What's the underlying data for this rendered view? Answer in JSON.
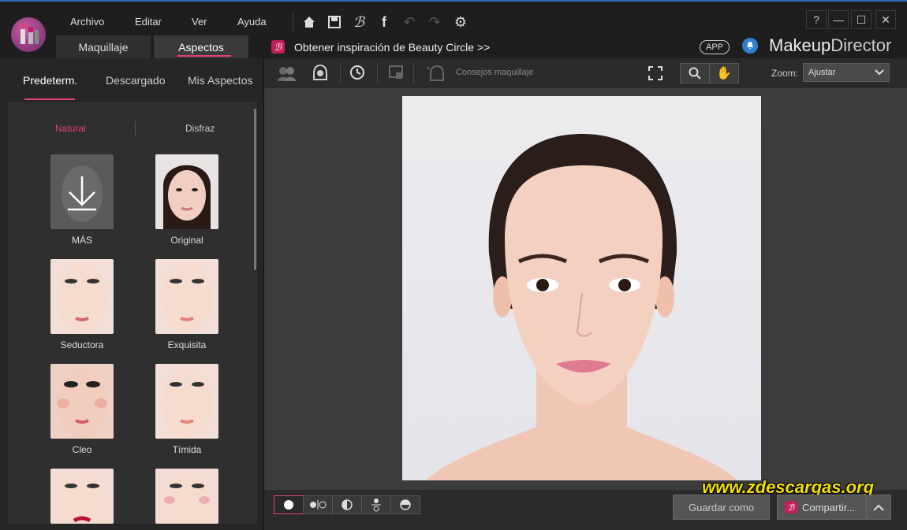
{
  "menu": {
    "file": "Archivo",
    "edit": "Editar",
    "view": "Ver",
    "help": "Ayuda"
  },
  "modes": {
    "makeup": "Maquillaje",
    "looks": "Aspectos"
  },
  "beauty_circle": "Obtener inspiración de Beauty Circle >>",
  "app_badge": "APP",
  "brand": {
    "part1": "Makeup",
    "part2": "Director"
  },
  "window": {
    "help": "?",
    "minimize": "—",
    "maximize": "☐",
    "close": "✕"
  },
  "left_tabs": {
    "preset": "Predeterm.",
    "downloaded": "Descargado",
    "mine": "Mis Aspectos"
  },
  "sub_tabs": {
    "natural": "Natural",
    "costume": "Disfraz"
  },
  "looks": [
    {
      "label": "MÁS"
    },
    {
      "label": "Original"
    },
    {
      "label": "Seductora"
    },
    {
      "label": "Exquisita"
    },
    {
      "label": "Cleo"
    },
    {
      "label": "Tímida"
    }
  ],
  "toolbar": {
    "tips": "Consejos maquillaje",
    "zoom_label": "Zoom:",
    "zoom_value": "Ajustar"
  },
  "bottom": {
    "save_as": "Guardar como",
    "share": "Compartir...",
    "watermark": "www.zdescargas.org"
  },
  "colors": {
    "accent": "#e0407a",
    "brand_blue": "#2b6cb0",
    "watermark": "#f4e000"
  }
}
